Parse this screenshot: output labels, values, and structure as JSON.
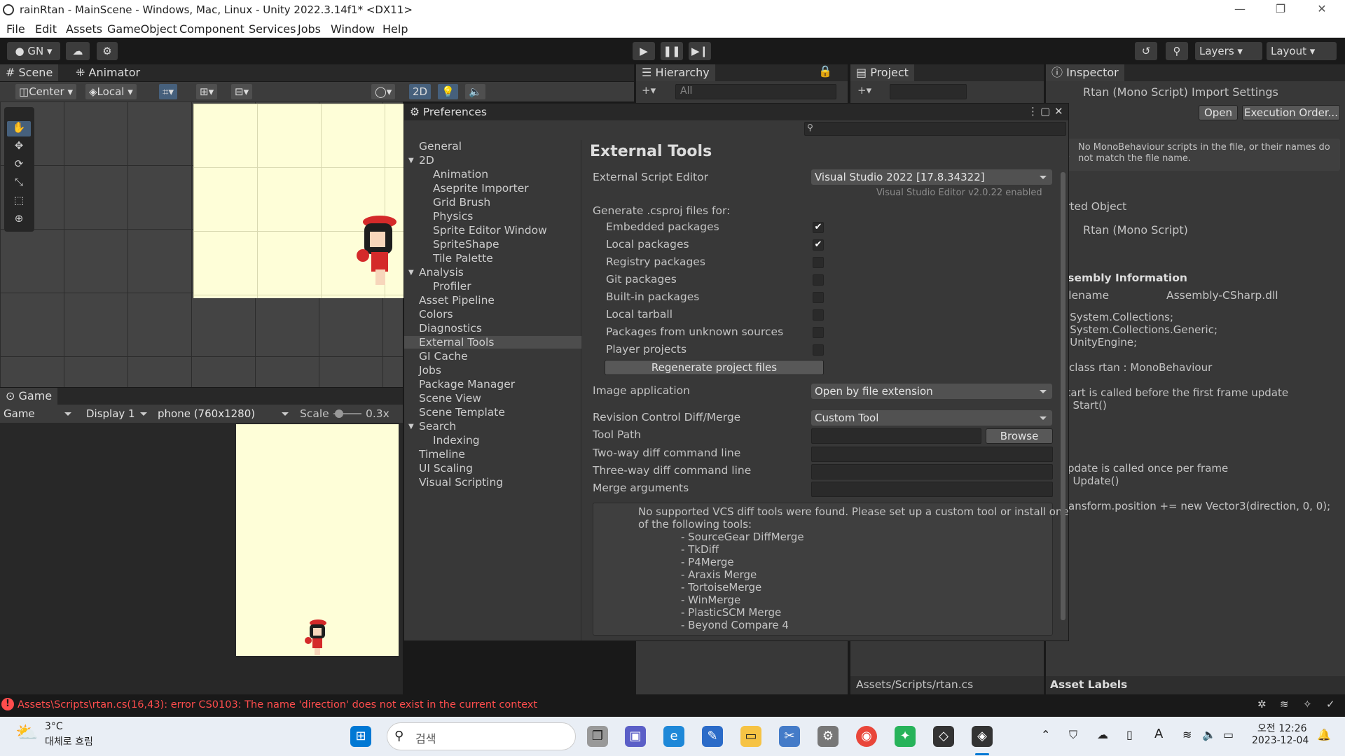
{
  "window": {
    "title": "rainRtan - MainScene - Windows, Mac, Linux - Unity 2022.3.14f1* <DX11>"
  },
  "menu": [
    "File",
    "Edit",
    "Assets",
    "GameObject",
    "Component",
    "Services",
    "Jobs",
    "Window",
    "Help"
  ],
  "toolbar": {
    "account": "GN",
    "layers": "Layers",
    "layout": "Layout"
  },
  "scene": {
    "tabs": [
      "Scene",
      "Animator"
    ],
    "pivot": "Center",
    "space": "Local",
    "mode2d": "2D"
  },
  "game": {
    "tab": "Game",
    "view": "Game",
    "display": "Display 1",
    "resolution": "phone (760x1280)",
    "scale_label": "Scale",
    "scale_value": "0.3x"
  },
  "hierarchy": {
    "tab": "Hierarchy",
    "search_placeholder": "All"
  },
  "project": {
    "tab": "Project",
    "path": "Assets/Scripts/rtan.cs"
  },
  "inspector": {
    "tab": "Inspector",
    "title": "Rtan (Mono Script) Import Settings",
    "open": "Open",
    "exec_order": "Execution Order...",
    "warning": "No MonoBehaviour scripts in the file, or their names do not match the file name.",
    "imported_object": "rted Object",
    "script_name": "Rtan (Mono Script)",
    "assembly_header": "ssembly Information",
    "filename_label": "ilename",
    "filename_value": "Assembly-CSharp.dll",
    "code": [
      "g System.Collections;",
      "g System.Collections.Generic;",
      "g UnityEngine;",
      "",
      "c class rtan : MonoBehaviour",
      "",
      "Start is called before the first frame update",
      "id Start()",
      "",
      "",
      "",
      "",
      "Update is called once per frame",
      "id Update()",
      "",
      "transform.position += new Vector3(direction, 0, 0);"
    ],
    "asset_labels": "Asset Labels"
  },
  "preferences": {
    "title": "Preferences",
    "categories": [
      {
        "label": "General",
        "indent": 0
      },
      {
        "label": "2D",
        "indent": 0,
        "arrow": true
      },
      {
        "label": "Animation",
        "indent": 1
      },
      {
        "label": "Aseprite Importer",
        "indent": 1
      },
      {
        "label": "Grid Brush",
        "indent": 1
      },
      {
        "label": "Physics",
        "indent": 1
      },
      {
        "label": "Sprite Editor Window",
        "indent": 1
      },
      {
        "label": "SpriteShape",
        "indent": 1
      },
      {
        "label": "Tile Palette",
        "indent": 1
      },
      {
        "label": "Analysis",
        "indent": 0,
        "arrow": true
      },
      {
        "label": "Profiler",
        "indent": 1
      },
      {
        "label": "Asset Pipeline",
        "indent": 0
      },
      {
        "label": "Colors",
        "indent": 0
      },
      {
        "label": "Diagnostics",
        "indent": 0
      },
      {
        "label": "External Tools",
        "indent": 0,
        "selected": true
      },
      {
        "label": "GI Cache",
        "indent": 0
      },
      {
        "label": "Jobs",
        "indent": 0
      },
      {
        "label": "Package Manager",
        "indent": 0
      },
      {
        "label": "Scene View",
        "indent": 0
      },
      {
        "label": "Scene Template",
        "indent": 0
      },
      {
        "label": "Search",
        "indent": 0,
        "arrow": true
      },
      {
        "label": "Indexing",
        "indent": 1
      },
      {
        "label": "Timeline",
        "indent": 0
      },
      {
        "label": "UI Scaling",
        "indent": 0
      },
      {
        "label": "Visual Scripting",
        "indent": 0
      }
    ],
    "section_title": "External Tools",
    "script_editor_label": "External Script Editor",
    "script_editor_value": "Visual Studio 2022 [17.8.34322]",
    "editor_version": "Visual Studio Editor v2.0.22 enabled",
    "csproj_label": "Generate .csproj files for:",
    "packages": [
      {
        "label": "Embedded packages",
        "checked": true
      },
      {
        "label": "Local packages",
        "checked": true
      },
      {
        "label": "Registry packages",
        "checked": false
      },
      {
        "label": "Git packages",
        "checked": false
      },
      {
        "label": "Built-in packages",
        "checked": false
      },
      {
        "label": "Local tarball",
        "checked": false
      },
      {
        "label": "Packages from unknown sources",
        "checked": false
      },
      {
        "label": "Player projects",
        "checked": false
      }
    ],
    "regenerate": "Regenerate project files",
    "image_app_label": "Image application",
    "image_app_value": "Open by file extension",
    "revision_label": "Revision Control Diff/Merge",
    "revision_value": "Custom Tool",
    "tool_path_label": "Tool Path",
    "browse": "Browse",
    "two_way_label": "Two-way diff command line",
    "three_way_label": "Three-way diff command line",
    "merge_args_label": "Merge arguments",
    "vcs_message_1": "No supported VCS diff tools were found. Please set up a custom tool or install one",
    "vcs_message_2": "of the following tools:",
    "vcs_tools": [
      "- SourceGear DiffMerge",
      "- TkDiff",
      "- P4Merge",
      "- Araxis Merge",
      "- TortoiseMerge",
      "- WinMerge",
      "- PlasticSCM Merge",
      "- Beyond Compare 4"
    ]
  },
  "status": {
    "error": "Assets\\Scripts\\rtan.cs(16,43): error CS0103: The name 'direction' does not exist in the current context"
  },
  "taskbar": {
    "weather_temp": "3°C",
    "weather_desc": "대체로 흐림",
    "search_placeholder": "검색",
    "ampm_time": "오전 12:26",
    "date": "2023-12-04"
  },
  "colors": {
    "error": "#ff4d4d",
    "accent": "#3a79bb",
    "cream": "#fefed8"
  }
}
